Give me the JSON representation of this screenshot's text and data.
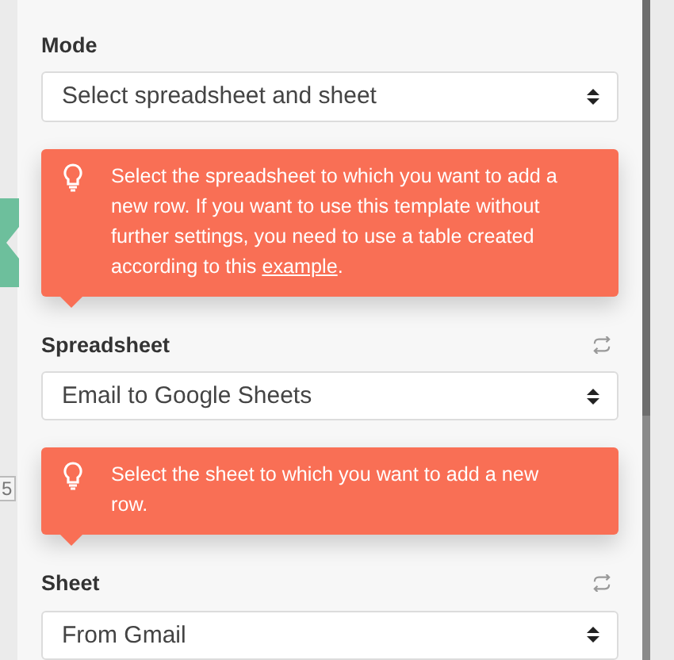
{
  "canvas": {
    "node_label": "5"
  },
  "fields": [
    {
      "label": "Mode",
      "refresh": false,
      "value": "Select spreadsheet and sheet",
      "hint": {
        "text": "Select the spreadsheet to which you want to add a new row. If you want to use this template without further settings, you need to use a table created according to this ",
        "link": "example",
        "after": "."
      }
    },
    {
      "label": "Spreadsheet",
      "refresh": true,
      "value": "Email to Google Sheets",
      "hint": {
        "text": "Select the sheet to which you want to add a new row."
      }
    },
    {
      "label": "Sheet",
      "refresh": true,
      "value": "From Gmail"
    }
  ]
}
